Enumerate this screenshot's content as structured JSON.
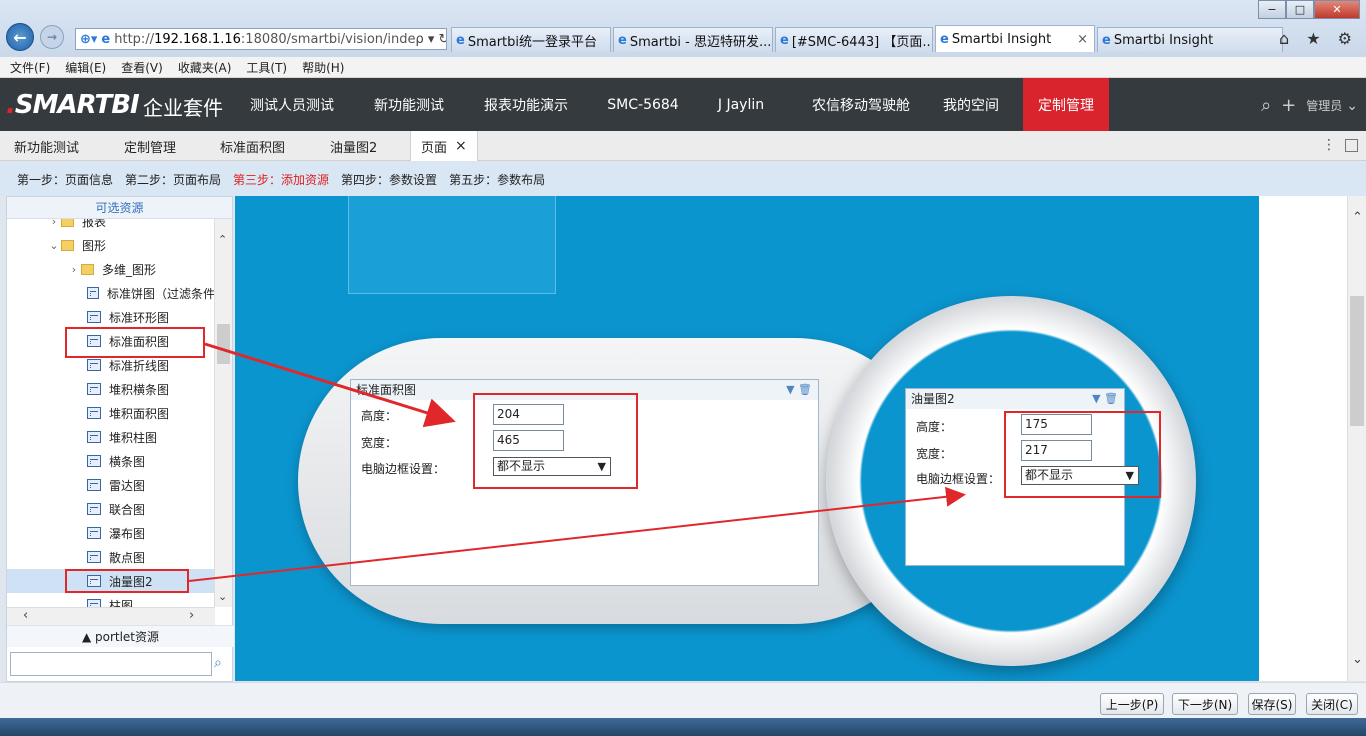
{
  "browser": {
    "address": {
      "prefix": "http://",
      "host": "192.168.1.16",
      "rest": ":18080/smartbi/vision/inde",
      "icons": "ρ ▾ ↻"
    },
    "tabs": [
      {
        "label": "Smartbi统一登录平台"
      },
      {
        "label": "Smartbi - 思迈特研发..."
      },
      {
        "label": "[#SMC-6443] 【页面..."
      },
      {
        "label": "Smartbi Insight",
        "close": "×"
      },
      {
        "label": "Smartbi Insight"
      }
    ],
    "window_controls": {
      "min": "−",
      "max": "□",
      "close": "✕"
    },
    "tool_icons": "⌂ ★ ⚙"
  },
  "menubar": [
    "文件(F)",
    "编辑(E)",
    "查看(V)",
    "收藏夹(A)",
    "工具(T)",
    "帮助(H)"
  ],
  "app": {
    "logo_main": "SMARTBI",
    "logo_suffix": "企业套件",
    "nav": [
      "测试人员测试",
      "新功能测试",
      "报表功能演示",
      "SMC-5684",
      "J Jaylin",
      "农信移动驾驶舱",
      "我的空间",
      "定制管理"
    ],
    "user": "管理员"
  },
  "page_tabs": [
    "新功能测试",
    "定制管理",
    "标准面积图",
    "油量图2",
    "页面"
  ],
  "page_tab_close": "×",
  "steps": [
    "第一步：页面信息",
    "第二步：页面布局",
    "第三步：添加资源",
    "第四步：参数设置",
    "第五步：参数布局"
  ],
  "left_panel": {
    "header": "可选资源",
    "tree": [
      {
        "label": "报表",
        "arrow": "›"
      },
      {
        "label": "图形",
        "arrow": "⌄"
      },
      {
        "label": "多维_图形",
        "arrow": "›"
      },
      {
        "label": "标准饼图（过滤条件"
      },
      {
        "label": "标准环形图"
      },
      {
        "label": "标准面积图"
      },
      {
        "label": "标准折线图"
      },
      {
        "label": "堆积横条图"
      },
      {
        "label": "堆积面积图"
      },
      {
        "label": "堆积柱图"
      },
      {
        "label": "横条图"
      },
      {
        "label": "雷达图"
      },
      {
        "label": "联合图"
      },
      {
        "label": "瀑布图"
      },
      {
        "label": "散点图"
      },
      {
        "label": "油量图2"
      },
      {
        "label": "柱图"
      }
    ],
    "portlet": "▲ portlet资源",
    "search_placeholder": ""
  },
  "panel_area": {
    "title": "标准面积图",
    "height_label": "高度：",
    "height_value": "204",
    "width_label": "宽度：",
    "width_value": "465",
    "border_label": "电脑边框设置：",
    "border_value": "都不显示"
  },
  "panel_gauge": {
    "title": "油量图2",
    "height_label": "高度：",
    "height_value": "175",
    "width_label": "宽度：",
    "width_value": "217",
    "border_label": "电脑边框设置：",
    "border_value": "都不显示"
  },
  "footer": {
    "prev": "上一步(P)",
    "next": "下一步(N)",
    "save": "保存(S)",
    "close": "关闭(C)"
  },
  "colors": {
    "accent_red": "#d9232d",
    "canvas_blue": "#0b95cf",
    "annotation_red": "#e0282b"
  }
}
